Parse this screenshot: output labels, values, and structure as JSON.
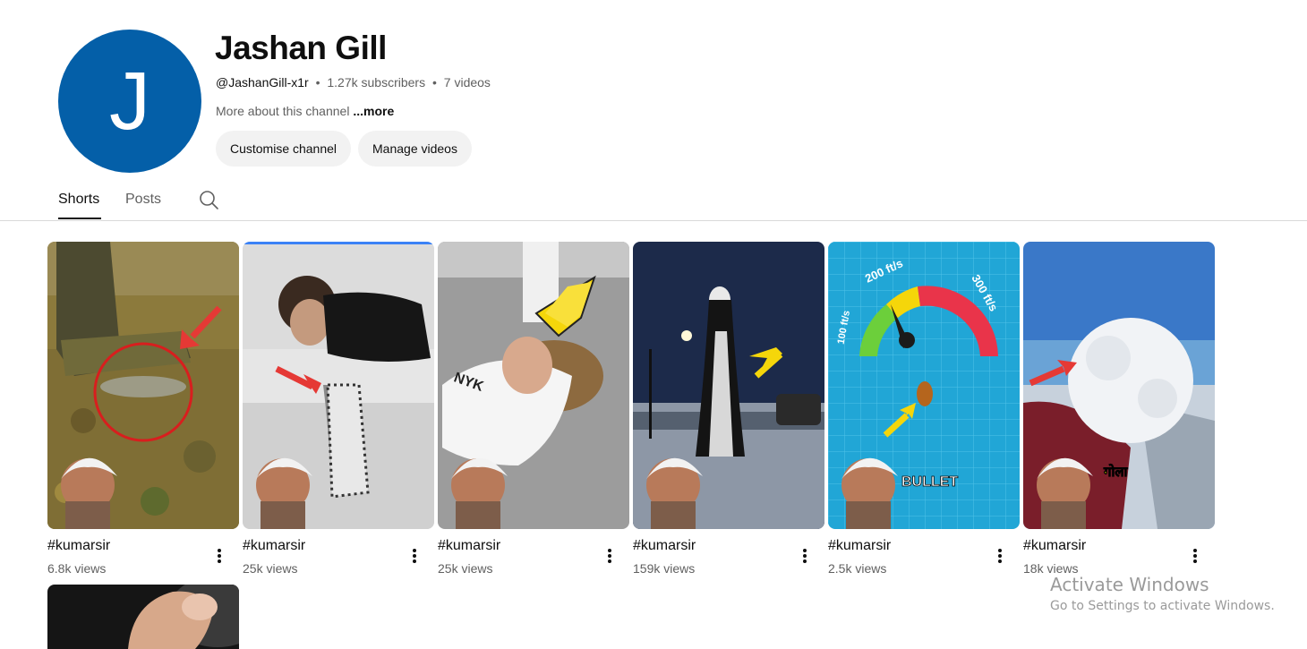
{
  "channel": {
    "avatar_letter": "J",
    "avatar_color": "#045fa8",
    "name": "Jashan Gill",
    "handle": "@JashanGill-x1r",
    "separator": "•",
    "subscribers": "1.27k subscribers",
    "videos": "7 videos",
    "about": "More about this channel",
    "more": "...more"
  },
  "buttons": {
    "customise": "Customise channel",
    "manage": "Manage videos"
  },
  "tabs": {
    "shorts": "Shorts",
    "posts": "Posts",
    "search_icon": "search-icon"
  },
  "shorts": [
    {
      "title": "#kumarsir",
      "views": "6.8k views",
      "theme": "landmine"
    },
    {
      "title": "#kumarsir",
      "views": "25k views",
      "theme": "couch"
    },
    {
      "title": "#kumarsir",
      "views": "25k views",
      "theme": "fallen-man"
    },
    {
      "title": "#kumarsir",
      "views": "159k views",
      "theme": "ghost-night"
    },
    {
      "title": "#kumarsir",
      "views": "2.5k views",
      "theme": "speedometer",
      "gauge_labels": [
        "100 ft/s",
        "200 ft/s",
        "300 ft/s"
      ],
      "caption": "BULLET"
    },
    {
      "title": "#kumarsir",
      "views": "18k views",
      "theme": "snowball",
      "caption": "गोला"
    }
  ],
  "watermark": {
    "title": "Activate Windows",
    "subtitle": "Go to Settings to activate Windows."
  }
}
